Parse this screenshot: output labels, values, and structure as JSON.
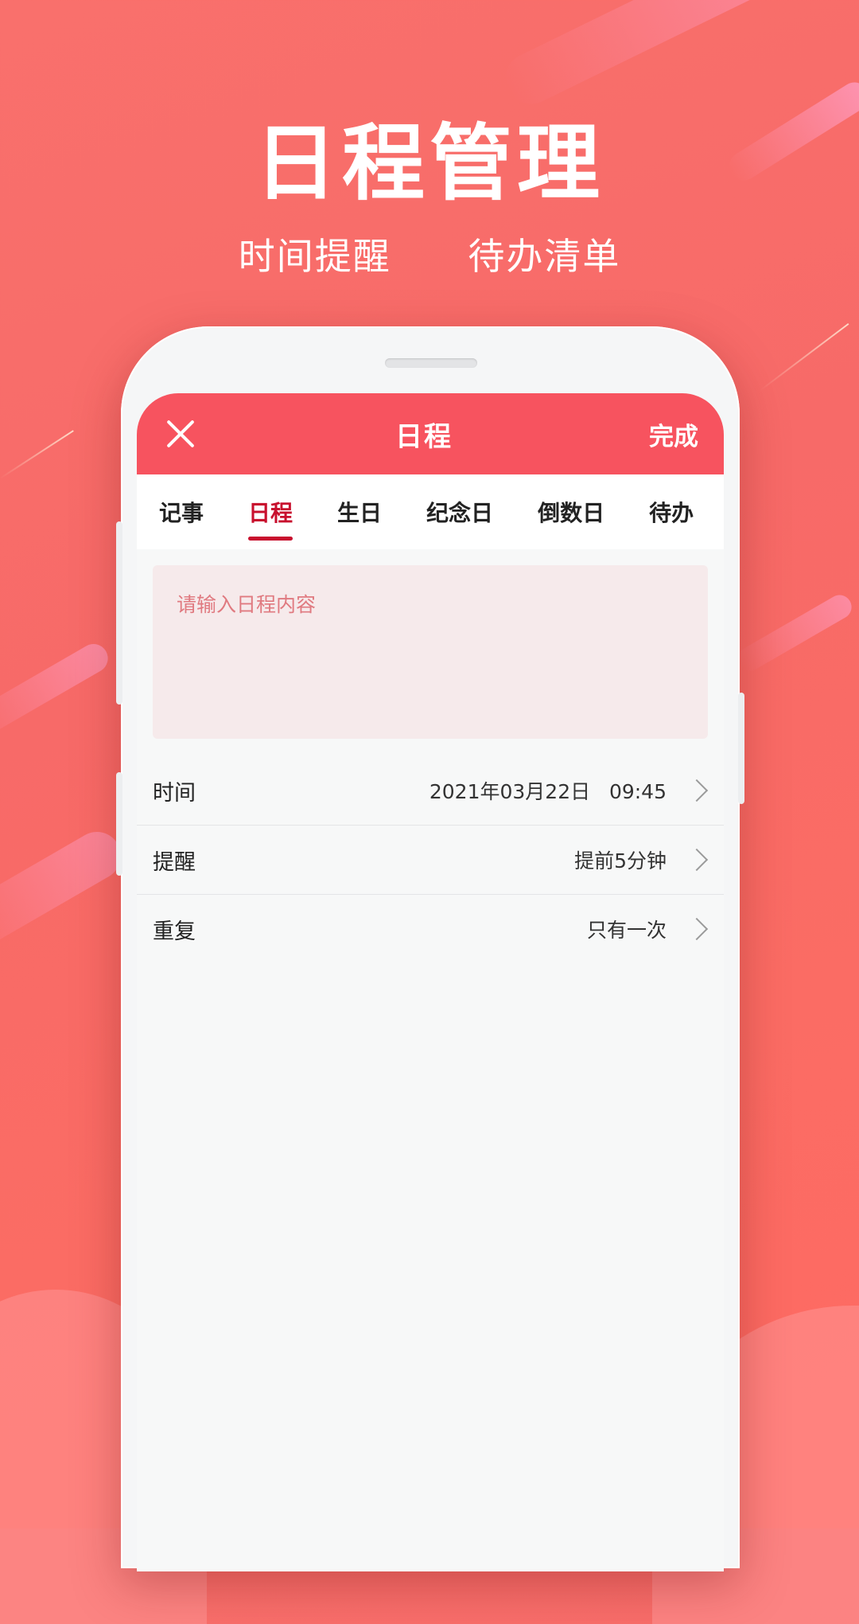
{
  "banner": {
    "headline": "日程管理",
    "features": [
      "时间提醒",
      "待办清单"
    ]
  },
  "app": {
    "header": {
      "title": "日程",
      "close_icon": "close-icon",
      "done_label": "完成"
    },
    "tabs": [
      {
        "label": "记事",
        "active": false
      },
      {
        "label": "日程",
        "active": true
      },
      {
        "label": "生日",
        "active": false
      },
      {
        "label": "纪念日",
        "active": false
      },
      {
        "label": "倒数日",
        "active": false
      },
      {
        "label": "待办",
        "active": false
      }
    ],
    "content": {
      "placeholder": "请输入日程内容"
    },
    "rows": [
      {
        "label": "时间",
        "value": "2021年03月22日   09:45"
      },
      {
        "label": "提醒",
        "value": "提前5分钟"
      },
      {
        "label": "重复",
        "value": "只有一次"
      }
    ]
  },
  "colors": {
    "header": "#f7535f",
    "active_tab": "#c8102e",
    "input_bg": "#f6eaeb",
    "placeholder": "#e07a80"
  }
}
